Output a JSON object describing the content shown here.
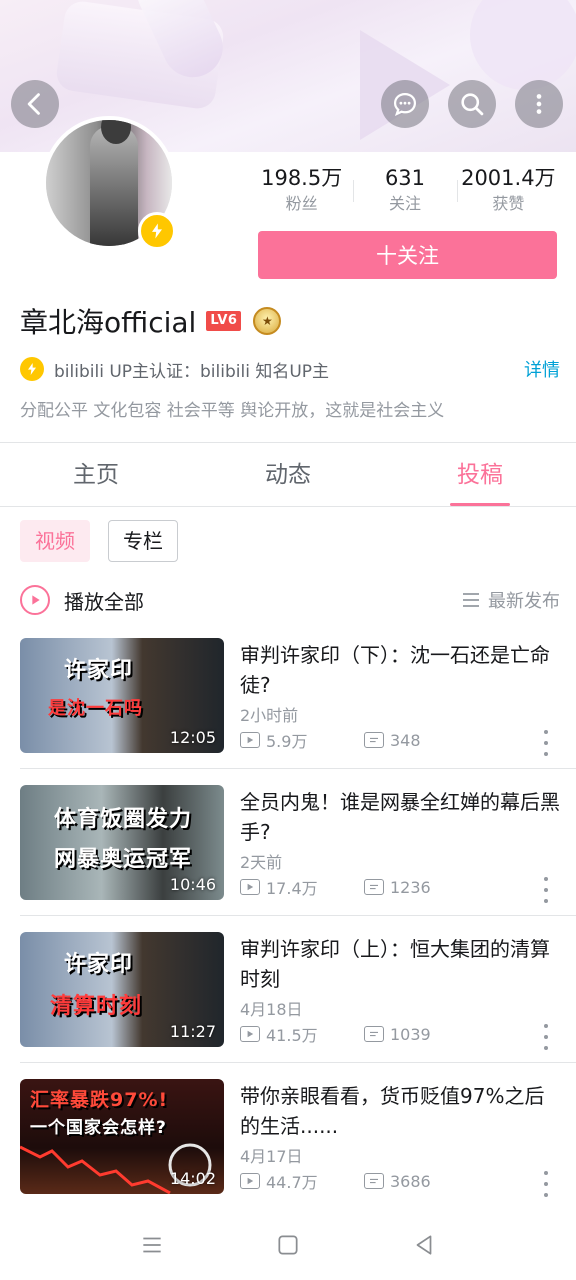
{
  "header": {
    "back_icon": "chevron-left-icon",
    "actions": [
      "message-icon",
      "search-icon",
      "more-vertical-icon"
    ]
  },
  "profile": {
    "name": "章北海official",
    "level": "LV6",
    "stats": [
      {
        "value": "198.5万",
        "label": "粉丝"
      },
      {
        "value": "631",
        "label": "关注"
      },
      {
        "value": "2001.4万",
        "label": "获赞"
      }
    ],
    "follow_label": "十关注",
    "certification": "bilibili UP主认证：bilibili 知名UP主",
    "cert_more": "详情",
    "bio": "分配公平 文化包容 社会平等 舆论开放，这就是社会主义"
  },
  "tabs": [
    {
      "label": "主页",
      "active": false
    },
    {
      "label": "动态",
      "active": false
    },
    {
      "label": "投稿",
      "active": true
    }
  ],
  "chips": [
    {
      "label": "视频",
      "active": true
    },
    {
      "label": "专栏",
      "active": false
    }
  ],
  "list_header": {
    "play_all": "播放全部",
    "sort": "最新发布"
  },
  "videos": [
    {
      "title": "审判许家印（下）：沈一石还是亡命徒?",
      "date": "2小时前",
      "views": "5.9万",
      "danmaku": "348",
      "duration": "12:05",
      "thumb_line1": "许家印",
      "thumb_line2": "是沈一石吗"
    },
    {
      "title": "全员内鬼！谁是网暴全红婵的幕后黑手?",
      "date": "2天前",
      "views": "17.4万",
      "danmaku": "1236",
      "duration": "10:46",
      "thumb_line1": "体育饭圈发力",
      "thumb_line2": "网暴奥运冠军"
    },
    {
      "title": "审判许家印（上）：恒大集团的清算时刻",
      "date": "4月18日",
      "views": "41.5万",
      "danmaku": "1039",
      "duration": "11:27",
      "thumb_line1": "许家印",
      "thumb_line2": "清算时刻"
    },
    {
      "title": "带你亲眼看看，货币贬值97%之后的生活......",
      "date": "4月17日",
      "views": "44.7万",
      "danmaku": "3686",
      "duration": "14:02",
      "thumb_line1": "汇率暴跌97%!",
      "thumb_line2": "一个国家会怎样?"
    }
  ],
  "colors": {
    "brand_pink": "#fb7299",
    "link_blue": "#00a1d6",
    "badge_yellow": "#ffc700",
    "level_red": "#f04c49"
  }
}
